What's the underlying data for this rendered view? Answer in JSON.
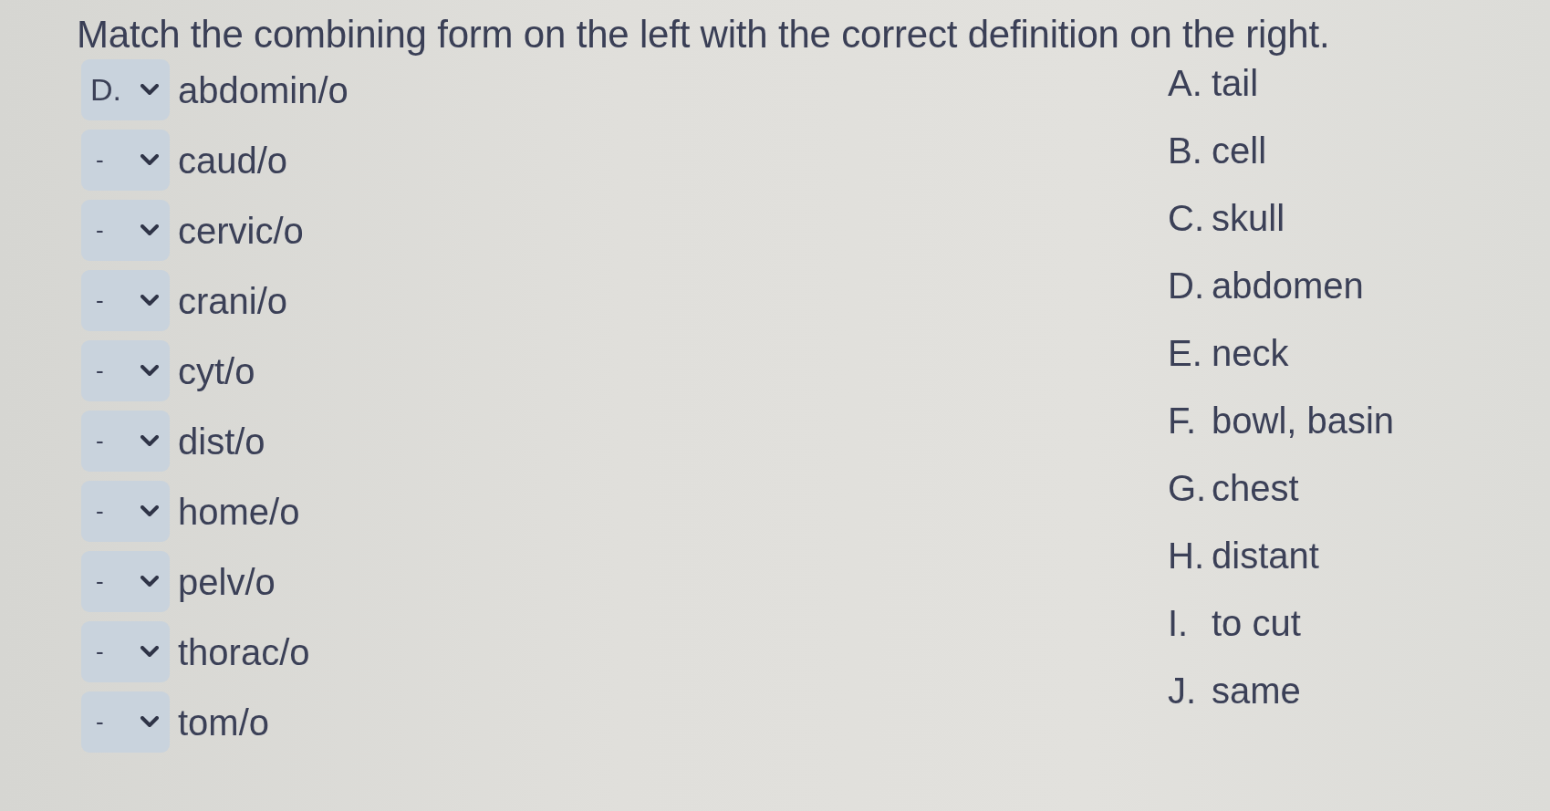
{
  "instruction": "Match the combining form on the left with the correct definition on the right.",
  "matches": [
    {
      "answer": "D.",
      "term": "abdomin/o"
    },
    {
      "answer": "-",
      "term": "caud/o"
    },
    {
      "answer": "-",
      "term": "cervic/o"
    },
    {
      "answer": "-",
      "term": "crani/o"
    },
    {
      "answer": "-",
      "term": "cyt/o"
    },
    {
      "answer": "-",
      "term": "dist/o"
    },
    {
      "answer": "-",
      "term": "home/o"
    },
    {
      "answer": "-",
      "term": "pelv/o"
    },
    {
      "answer": "-",
      "term": "thorac/o"
    },
    {
      "answer": "-",
      "term": "tom/o"
    }
  ],
  "definitions": [
    {
      "letter": "A.",
      "text": "tail"
    },
    {
      "letter": "B.",
      "text": "cell"
    },
    {
      "letter": "C.",
      "text": "skull"
    },
    {
      "letter": "D.",
      "text": "abdomen"
    },
    {
      "letter": "E.",
      "text": "neck"
    },
    {
      "letter": "F.",
      "text": "bowl, basin"
    },
    {
      "letter": "G.",
      "text": "chest"
    },
    {
      "letter": "H.",
      "text": "distant"
    },
    {
      "letter": "I.",
      "text": "to cut"
    },
    {
      "letter": "J.",
      "text": "same"
    }
  ]
}
